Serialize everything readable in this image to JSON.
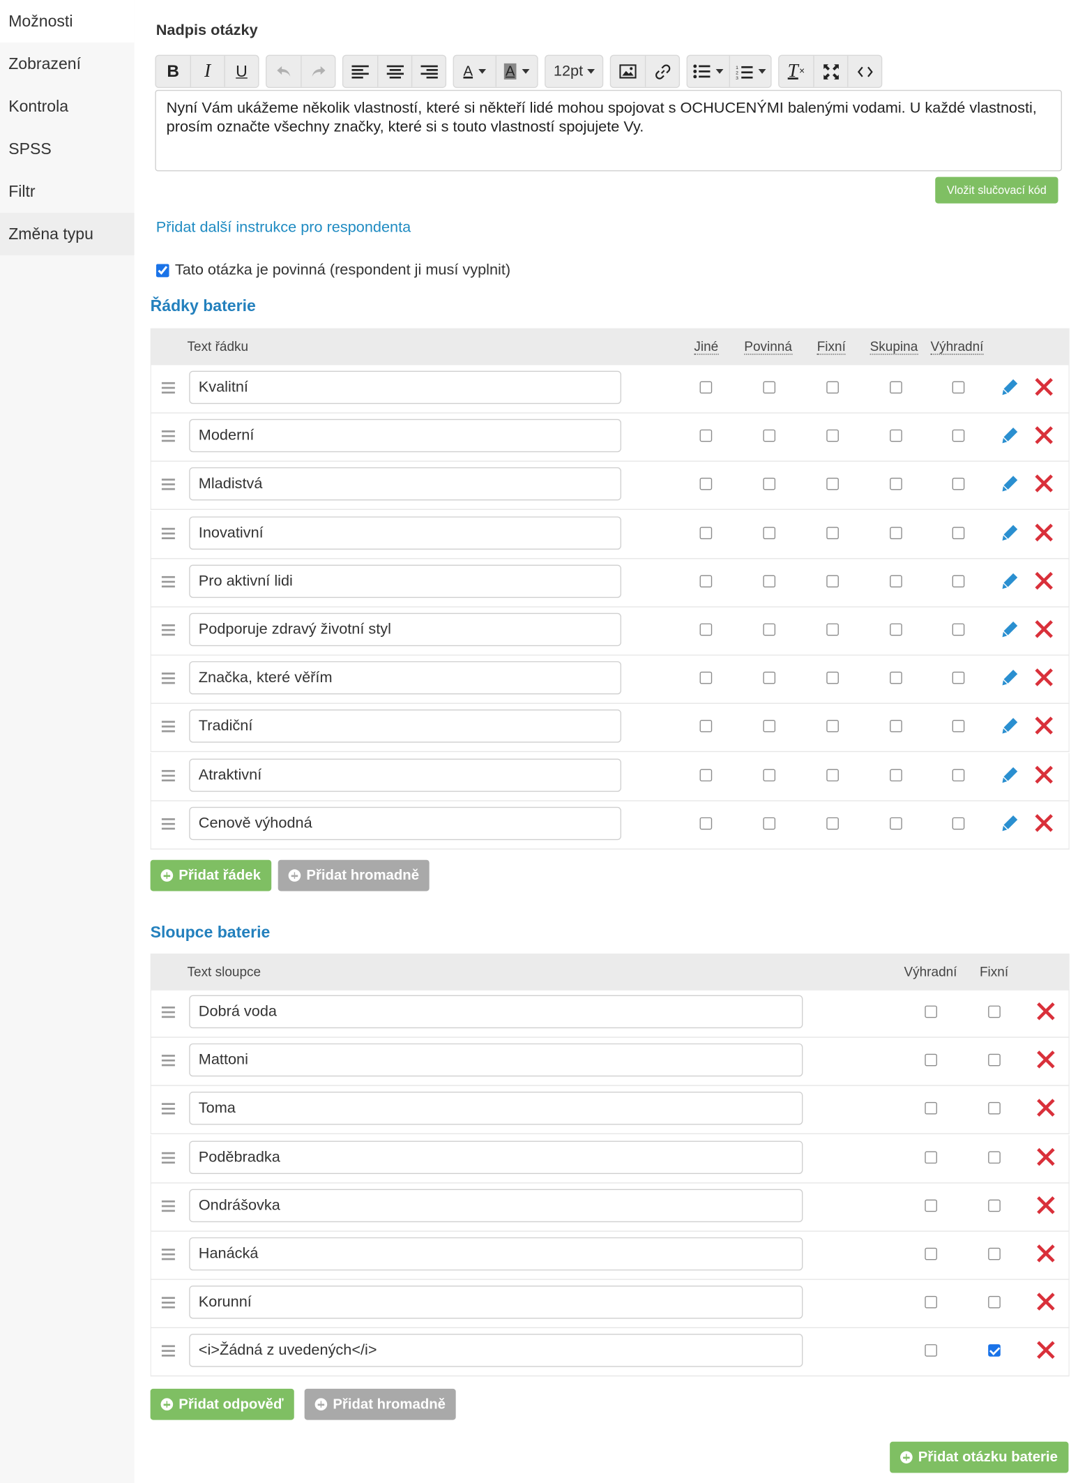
{
  "sidebar": {
    "items": [
      {
        "label": "Možnosti"
      },
      {
        "label": "Zobrazení"
      },
      {
        "label": "Kontrola"
      },
      {
        "label": "SPSS"
      },
      {
        "label": "Filtr"
      },
      {
        "label": "Změna typu"
      }
    ]
  },
  "question": {
    "title_label": "Nadpis otázky",
    "text": "Nyní Vám ukážeme několik vlastností, které si někteří lidé mohou spojovat s OCHUCENÝMI balenými vodami. U každé vlastnosti, prosím označte všechny značky, které si s touto vlastností spojujete Vy.",
    "merge_code_button": "Vložit slučovací kód",
    "instructions_link": "Přidat další instrukce pro respondenta",
    "required_label": "Tato otázka je povinná (respondent ji musí vyplnit)",
    "required_checked": true
  },
  "toolbar": {
    "font_size": "12pt",
    "icons": [
      "bold-icon",
      "italic-icon",
      "underline-icon",
      "undo-icon",
      "redo-icon",
      "align-left-icon",
      "align-center-icon",
      "align-right-icon",
      "text-color-icon",
      "background-color-icon",
      "font-size",
      "image-icon",
      "link-icon",
      "bullet-list-icon",
      "numbered-list-icon",
      "clear-format-icon",
      "fullscreen-icon",
      "code-icon"
    ]
  },
  "rows_section": {
    "title": "Řádky baterie",
    "headers": {
      "text": "Text řádku",
      "other": "Jiné",
      "required": "Povinná",
      "fixed": "Fixní",
      "group": "Skupina",
      "exclusive": "Výhradní"
    },
    "rows": [
      {
        "text": "Kvalitní"
      },
      {
        "text": "Moderní"
      },
      {
        "text": "Mladistvá"
      },
      {
        "text": "Inovativní"
      },
      {
        "text": "Pro aktivní lidi"
      },
      {
        "text": "Podporuje zdravý životní styl"
      },
      {
        "text": "Značka, které věřím"
      },
      {
        "text": "Tradiční"
      },
      {
        "text": "Atraktivní"
      },
      {
        "text": "Cenově výhodná"
      }
    ],
    "add_button": "Přidat řádek",
    "bulk_button": "Přidat hromadně"
  },
  "columns_section": {
    "title": "Sloupce baterie",
    "headers": {
      "text": "Text sloupce",
      "exclusive": "Výhradní",
      "fixed": "Fixní"
    },
    "columns": [
      {
        "text": "Dobrá voda",
        "fixed": false
      },
      {
        "text": "Mattoni",
        "fixed": false
      },
      {
        "text": "Toma",
        "fixed": false
      },
      {
        "text": "Poděbradka",
        "fixed": false
      },
      {
        "text": "Ondrášovka",
        "fixed": false
      },
      {
        "text": "Hanácká",
        "fixed": false
      },
      {
        "text": "Korunní",
        "fixed": false
      },
      {
        "text": "<i>Žádná z uvedených</i>",
        "fixed": true
      }
    ],
    "add_button": "Přidat odpověď",
    "bulk_button": "Přidat hromadně"
  },
  "footer": {
    "add_battery_button": "Přidat otázku baterie"
  },
  "colors": {
    "accent_green": "#7fbf63",
    "link_blue": "#1f8bc2",
    "delete_red": "#d9303a",
    "edit_blue": "#2a8fd0"
  }
}
